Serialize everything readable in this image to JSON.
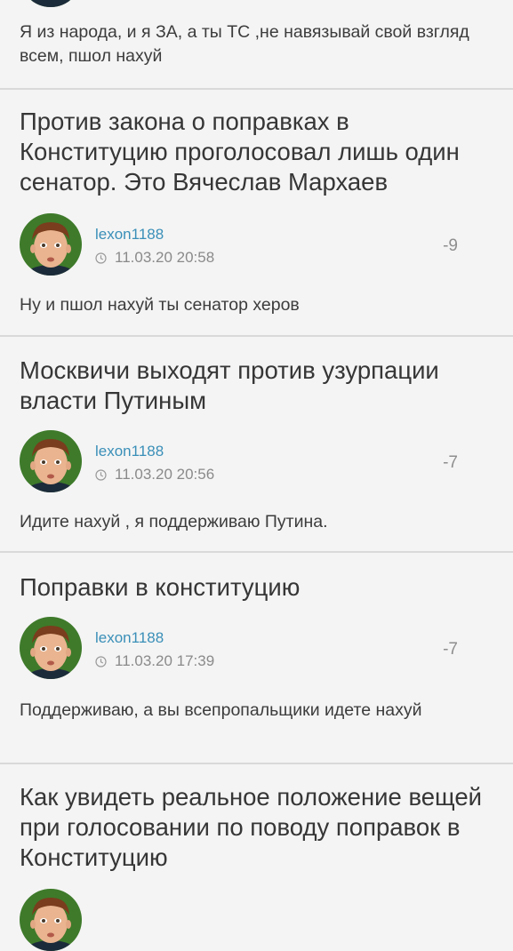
{
  "posts": [
    {
      "comment": "Я из народа, и я ЗА, а ты ТС ,не навязывай свой взгляд всем, пшол нахуй"
    },
    {
      "title": "Против закона о поправках в Конституцию проголосовал лишь один сенатор. Это Вячеслав Мархаев",
      "username": "lexon1188",
      "time": "11.03.20 20:58",
      "rating": "-9",
      "comment": "Ну и пшол нахуй ты сенатор херов"
    },
    {
      "title": "Москвичи выходят против узурпации власти Путиным",
      "username": "lexon1188",
      "time": "11.03.20 20:56",
      "rating": "-7",
      "comment": "Идите нахуй , я поддерживаю Путина."
    },
    {
      "title": "Поправки в конституцию",
      "username": "lexon1188",
      "time": "11.03.20 17:39",
      "rating": "-7",
      "comment": "Поддерживаю, а вы всепропальщики идете нахуй"
    },
    {
      "title": "Как увидеть реальное положение вещей при голосовании по поводу поправок в Конституцию"
    }
  ],
  "icons": {
    "avatar": "avatar-image",
    "clock": "clock-icon"
  },
  "colors": {
    "username": "#3a8fb8",
    "background": "#f4f4f4",
    "divider": "#d9d9d9"
  }
}
